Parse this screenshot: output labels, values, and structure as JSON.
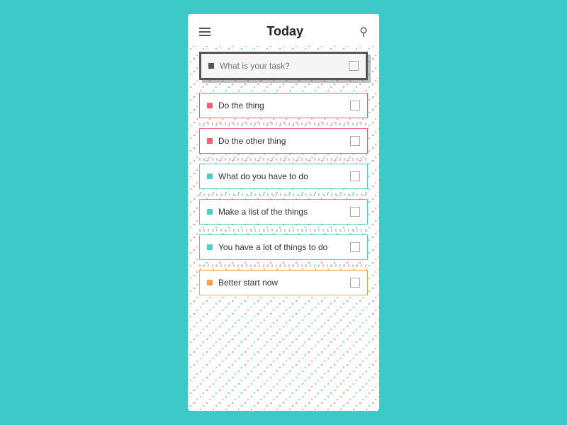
{
  "header": {
    "title": "Today",
    "menu_icon": "hamburger",
    "search_icon": "search"
  },
  "new_task": {
    "placeholder": "What is your task?"
  },
  "tasks": [
    {
      "id": 1,
      "label": "Do the thing",
      "color": "red",
      "checked": false
    },
    {
      "id": 2,
      "label": "Do the other thing",
      "color": "red",
      "checked": false
    },
    {
      "id": 3,
      "label": "What do you have to do",
      "color": "teal",
      "checked": false
    },
    {
      "id": 4,
      "label": "Make a list of the things",
      "color": "teal",
      "checked": false
    },
    {
      "id": 5,
      "label": "You have a lot of things to do",
      "color": "teal",
      "checked": false
    },
    {
      "id": 6,
      "label": "Better start now",
      "color": "orange",
      "checked": false
    }
  ]
}
